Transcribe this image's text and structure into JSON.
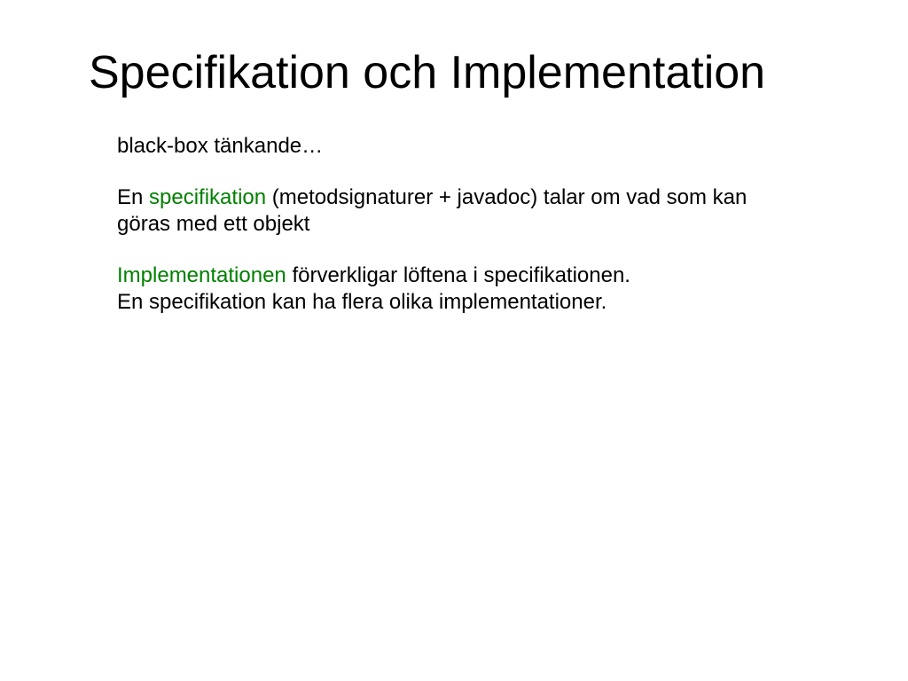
{
  "title": "Specifikation och Implementation",
  "p1": "black-box tänkande…",
  "p2_kw_pre": "En ",
  "p2_kw": "specifikation",
  "p2_rest": " (metodsignaturer + javadoc) talar om vad som kan göras med ett objekt",
  "p3_kw": "Implementationen",
  "p3_rest": " förverkligar löftena i specifikationen.",
  "p3_line2": "En specifikation kan ha flera olika implementationer."
}
